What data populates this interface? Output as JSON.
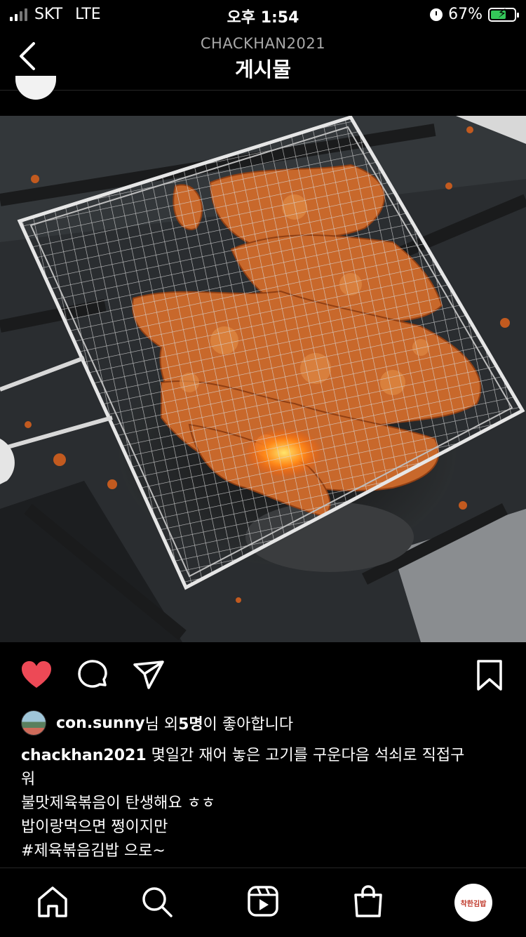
{
  "status_bar": {
    "carrier": "SKT",
    "network": "LTE",
    "time": "오후 1:54",
    "battery_percent_text": "67%",
    "battery_level": 0.67,
    "battery_color": "#34c759"
  },
  "header": {
    "username": "CHACKHAN2021",
    "title": "게시물",
    "back_icon": "chevron-left-icon"
  },
  "post": {
    "actions": {
      "like_icon": "heart-filled-icon",
      "like_color": "#ed4956",
      "comment_icon": "comment-icon",
      "share_icon": "paper-plane-icon",
      "save_icon": "bookmark-icon"
    },
    "likes": {
      "user": "con.sunny",
      "mid": "님 외 ",
      "count": "5명",
      "suffix": "이 좋아합니다"
    },
    "caption": {
      "user": "chackhan2021",
      "line1": " 몇일간 재어 놓은 고기를 구운다음 석쇠로 직접구",
      "line2": "워",
      "line3": "불맛제육볶음이 탄생해요 ㅎㅎ",
      "line4": "밥이랑먹으면 쩡이지만",
      "line5": "#제육볶음김밥 으로~"
    }
  },
  "tabbar": {
    "home_icon": "home-icon",
    "search_icon": "search-icon",
    "reels_icon": "reels-icon",
    "shop_icon": "shopping-bag-icon",
    "profile_label": "착한김밥"
  }
}
